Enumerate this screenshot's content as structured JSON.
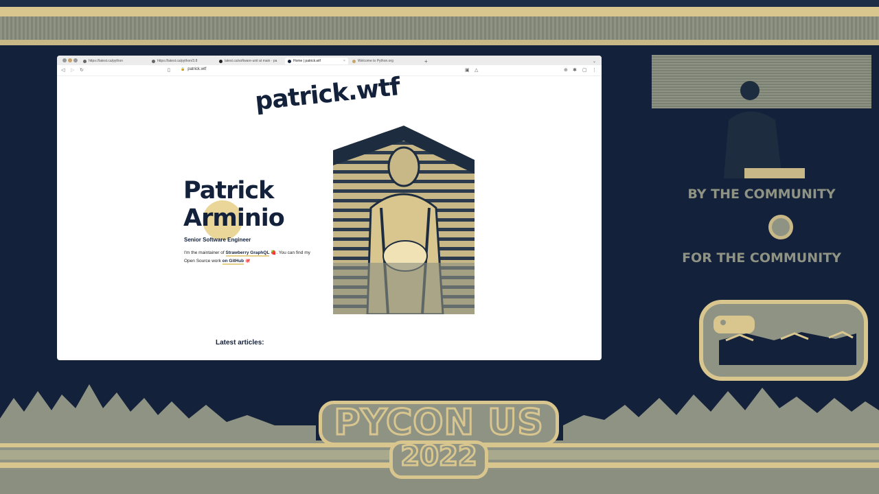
{
  "browser": {
    "tabs": [
      {
        "label": "https://latest.ca/python",
        "active": false
      },
      {
        "label": "https://latest.ca/python/3.8",
        "active": false
      },
      {
        "label": "latest.ca/software-unit at main · pa",
        "active": false
      },
      {
        "label": "Home | patrick.wtf",
        "active": true
      },
      {
        "label": "Welcome to Python.org",
        "active": false
      }
    ],
    "new_tab": "+",
    "url": "patrick.wtf"
  },
  "site": {
    "logo": "patrick.wtf",
    "name_first": "Patrick",
    "name_last": "Arminio",
    "job_title": "Senior Software Engineer",
    "bio_prefix": "I'm the maintainer of",
    "bio_link_1": "Strawberry GraphQL",
    "bio_emoji_1": "🍓",
    "bio_middle": "You can find my Open Source work",
    "bio_link_2": "on GitHub",
    "bio_emoji_2": "🐙",
    "latest_heading": "Latest articles:"
  },
  "conference": {
    "slogan_top": "BY THE COMMUNITY",
    "slogan_bottom": "FOR THE COMMUNITY",
    "event": "PYCON US",
    "year": "2022"
  },
  "colors": {
    "navy": "#13213a",
    "gold": "#d9c68f",
    "sage": "#8f9384"
  }
}
